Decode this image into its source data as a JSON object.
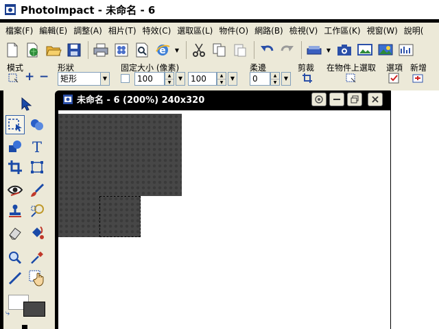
{
  "window": {
    "title": "PhotoImpact - 未命名 - 6"
  },
  "menu": {
    "items": [
      "檔案(F)",
      "編輯(E)",
      "調整(A)",
      "相片(T)",
      "特效(C)",
      "選取區(L)",
      "物件(O)",
      "網路(B)",
      "檢視(V)",
      "工作區(K)",
      "視窗(W)",
      "說明("
    ]
  },
  "toolbar": {
    "buttons": [
      "new-file-icon",
      "open-web-icon",
      "open-folder-icon",
      "save-icon",
      "print-icon",
      "batch-icon",
      "print-preview-icon",
      "browser-icon",
      "cut-icon",
      "copy-icon",
      "paste-icon",
      "undo-icon",
      "redo-icon",
      "scan-icon",
      "camera-icon",
      "capture-icon",
      "photo-icon",
      "chart-icon"
    ]
  },
  "propbar": {
    "mode_label": "模式",
    "shape_label": "形狀",
    "shape_value": "矩形",
    "fixed_size_label": "固定大小 (像素)",
    "width_value": "100",
    "height_value": "100",
    "soften_label": "柔邊",
    "soften_value": "0",
    "crop_label": "剪裁",
    "select_on_object_label": "在物件上選取",
    "options_label": "選項",
    "add_label": "新增"
  },
  "document": {
    "title": "未命名 - 6 (200%) 240x320"
  },
  "colors": {
    "accent": "#2f5ea8",
    "title_bg": "#000000",
    "image_fill": "#474747",
    "chrome": "#ece9d8"
  }
}
